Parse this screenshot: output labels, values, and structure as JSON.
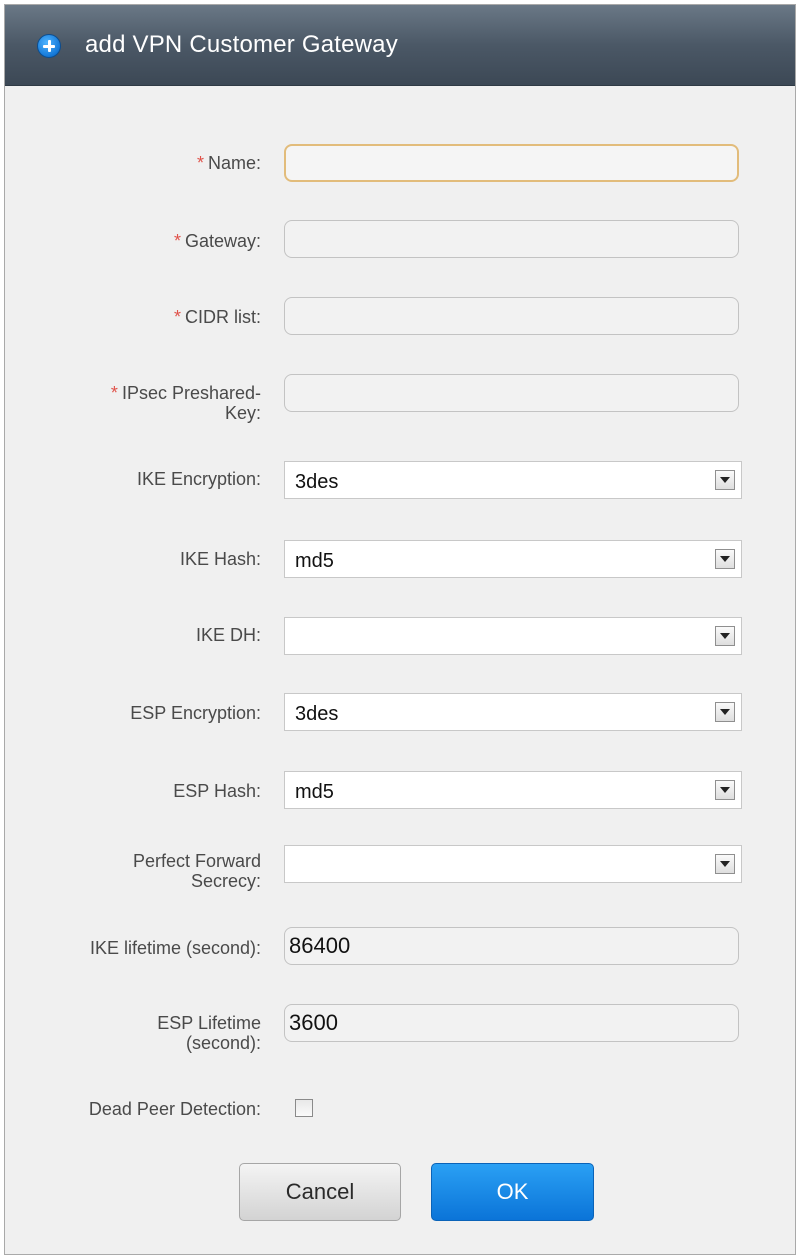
{
  "dialog": {
    "title": "add VPN Customer Gateway",
    "title_icon": "plus-circle-icon"
  },
  "form": {
    "name": {
      "required_mark": "*",
      "label": "Name:",
      "value": ""
    },
    "gateway": {
      "required_mark": "*",
      "label": "Gateway:",
      "value": ""
    },
    "cidr_list": {
      "required_mark": "*",
      "label": "CIDR list:",
      "value": ""
    },
    "ipsec_psk": {
      "required_mark": "*",
      "label_line1": "IPsec Preshared-",
      "label_line2": "Key:",
      "value": ""
    },
    "ike_encryption": {
      "label": "IKE Encryption:",
      "value": "3des"
    },
    "ike_hash": {
      "label": "IKE Hash:",
      "value": "md5"
    },
    "ike_dh": {
      "label": "IKE DH:",
      "value": ""
    },
    "esp_encryption": {
      "label": "ESP Encryption:",
      "value": "3des"
    },
    "esp_hash": {
      "label": "ESP Hash:",
      "value": "md5"
    },
    "pfs": {
      "label_line1": "Perfect Forward",
      "label_line2": "Secrecy:",
      "value": ""
    },
    "ike_lifetime": {
      "label": "IKE lifetime (second):",
      "value": "86400"
    },
    "esp_lifetime": {
      "label_line1": "ESP Lifetime",
      "label_line2": "(second):",
      "value": "3600"
    },
    "dead_peer_detection": {
      "label": "Dead Peer Detection:",
      "checked": false
    }
  },
  "buttons": {
    "cancel": "Cancel",
    "ok": "OK"
  },
  "colors": {
    "required": "#e0524a",
    "ok_button": "#1a8ae6",
    "titlebar": "#4b5866",
    "focus_border": "#e2bc7b"
  }
}
